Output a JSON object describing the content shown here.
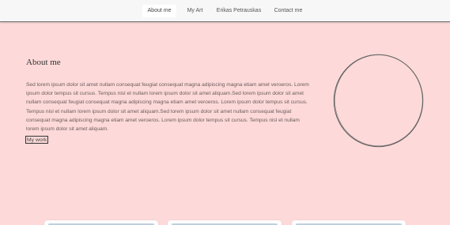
{
  "nav": {
    "items": [
      {
        "label": "About me",
        "active": true
      },
      {
        "label": "My Art",
        "active": false
      },
      {
        "label": "Erikas Petrauskas",
        "active": false
      },
      {
        "label": "Contact me",
        "active": false
      }
    ]
  },
  "about": {
    "title": "About me",
    "text": "Sed lorem ipsum dolor sit amet nullam consequat feugiat consequat magna adipiscing magna etiam amet veroeros. Lorem ipsum dolor tempus sit cursus. Tempus nisl et nullam lorem ipsum dolor sit amet aliquam.Sed lorem ipsum dolor sit amet nullam consequat feugiat consequat magna adipiscing magna etiam amet veroeros. Lorem ipsum dolor tempus sit cursus. Tempus nisl et nullam lorem ipsum dolor sit amet aliquam.Sed lorem ipsum dolor sit amet nullam consequat feugiat consequat magna adipiscing magna etiam amet veroeros. Lorem ipsum dolor tempus sit cursus. Tempus nisl et nullam lorem ipsum dolor sit amet aliquam.",
    "button_label": "My work"
  },
  "colors": {
    "background": "#fdd9d9",
    "navbar": "#f7f7f7",
    "text": "#6b5c5c"
  }
}
